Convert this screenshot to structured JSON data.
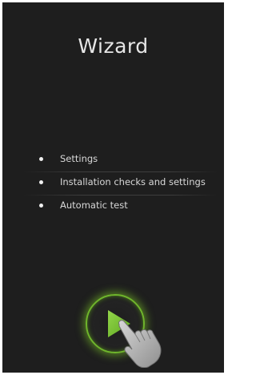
{
  "wizard": {
    "title": "Wizard",
    "steps": [
      {
        "label": "Settings"
      },
      {
        "label": "Installation checks and settings"
      },
      {
        "label": "Automatic test"
      }
    ]
  },
  "play_button": {
    "icon": "play-icon",
    "accent_color": "#7bc23a"
  },
  "hand": {
    "icon": "hand-pointer-icon"
  },
  "colors": {
    "background": "#1e1e1e",
    "text": "#d8d8d8",
    "accent": "#7bc23a"
  }
}
